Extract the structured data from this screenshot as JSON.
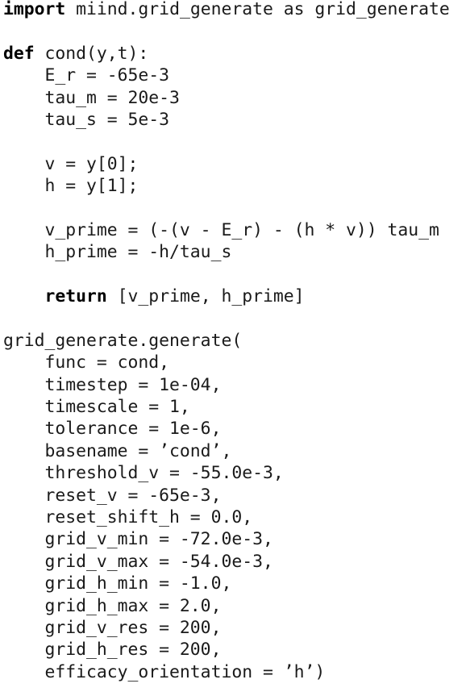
{
  "listing": {
    "language": "Python",
    "background_color": "#ffffff",
    "text_color": "#1a1a1a",
    "keyword_color": "#000000",
    "lines": [
      {
        "keyword": "import",
        "text": " miind.grid_generate as grid_generate"
      },
      {
        "keyword": "",
        "text": ""
      },
      {
        "keyword": "def",
        "text": " cond(y,t):"
      },
      {
        "keyword": "",
        "text": "    E_r = -65e-3"
      },
      {
        "keyword": "",
        "text": "    tau_m = 20e-3"
      },
      {
        "keyword": "",
        "text": "    tau_s = 5e-3"
      },
      {
        "keyword": "",
        "text": ""
      },
      {
        "keyword": "",
        "text": "    v = y[0];"
      },
      {
        "keyword": "",
        "text": "    h = y[1];"
      },
      {
        "keyword": "",
        "text": ""
      },
      {
        "keyword": "",
        "text": "    v_prime = (-(v - E_r) - (h * v)) tau_m"
      },
      {
        "keyword": "",
        "text": "    h_prime = -h/tau_s"
      },
      {
        "keyword": "",
        "text": ""
      },
      {
        "keyword": "    return",
        "text": " [v_prime, h_prime]"
      },
      {
        "keyword": "",
        "text": ""
      },
      {
        "keyword": "",
        "text": "grid_generate.generate("
      },
      {
        "keyword": "",
        "text": "    func = cond,"
      },
      {
        "keyword": "",
        "text": "    timestep = 1e-04,"
      },
      {
        "keyword": "",
        "text": "    timescale = 1,"
      },
      {
        "keyword": "",
        "text": "    tolerance = 1e-6,"
      },
      {
        "keyword": "",
        "text": "    basename = ’cond’,"
      },
      {
        "keyword": "",
        "text": "    threshold_v = -55.0e-3,"
      },
      {
        "keyword": "",
        "text": "    reset_v = -65e-3,"
      },
      {
        "keyword": "",
        "text": "    reset_shift_h = 0.0,"
      },
      {
        "keyword": "",
        "text": "    grid_v_min = -72.0e-3,"
      },
      {
        "keyword": "",
        "text": "    grid_v_max = -54.0e-3,"
      },
      {
        "keyword": "",
        "text": "    grid_h_min = -1.0,"
      },
      {
        "keyword": "",
        "text": "    grid_h_max = 2.0,"
      },
      {
        "keyword": "",
        "text": "    grid_v_res = 200,"
      },
      {
        "keyword": "",
        "text": "    grid_h_res = 200,"
      },
      {
        "keyword": "",
        "text": "    efficacy_orientation = ’h’)"
      }
    ]
  }
}
